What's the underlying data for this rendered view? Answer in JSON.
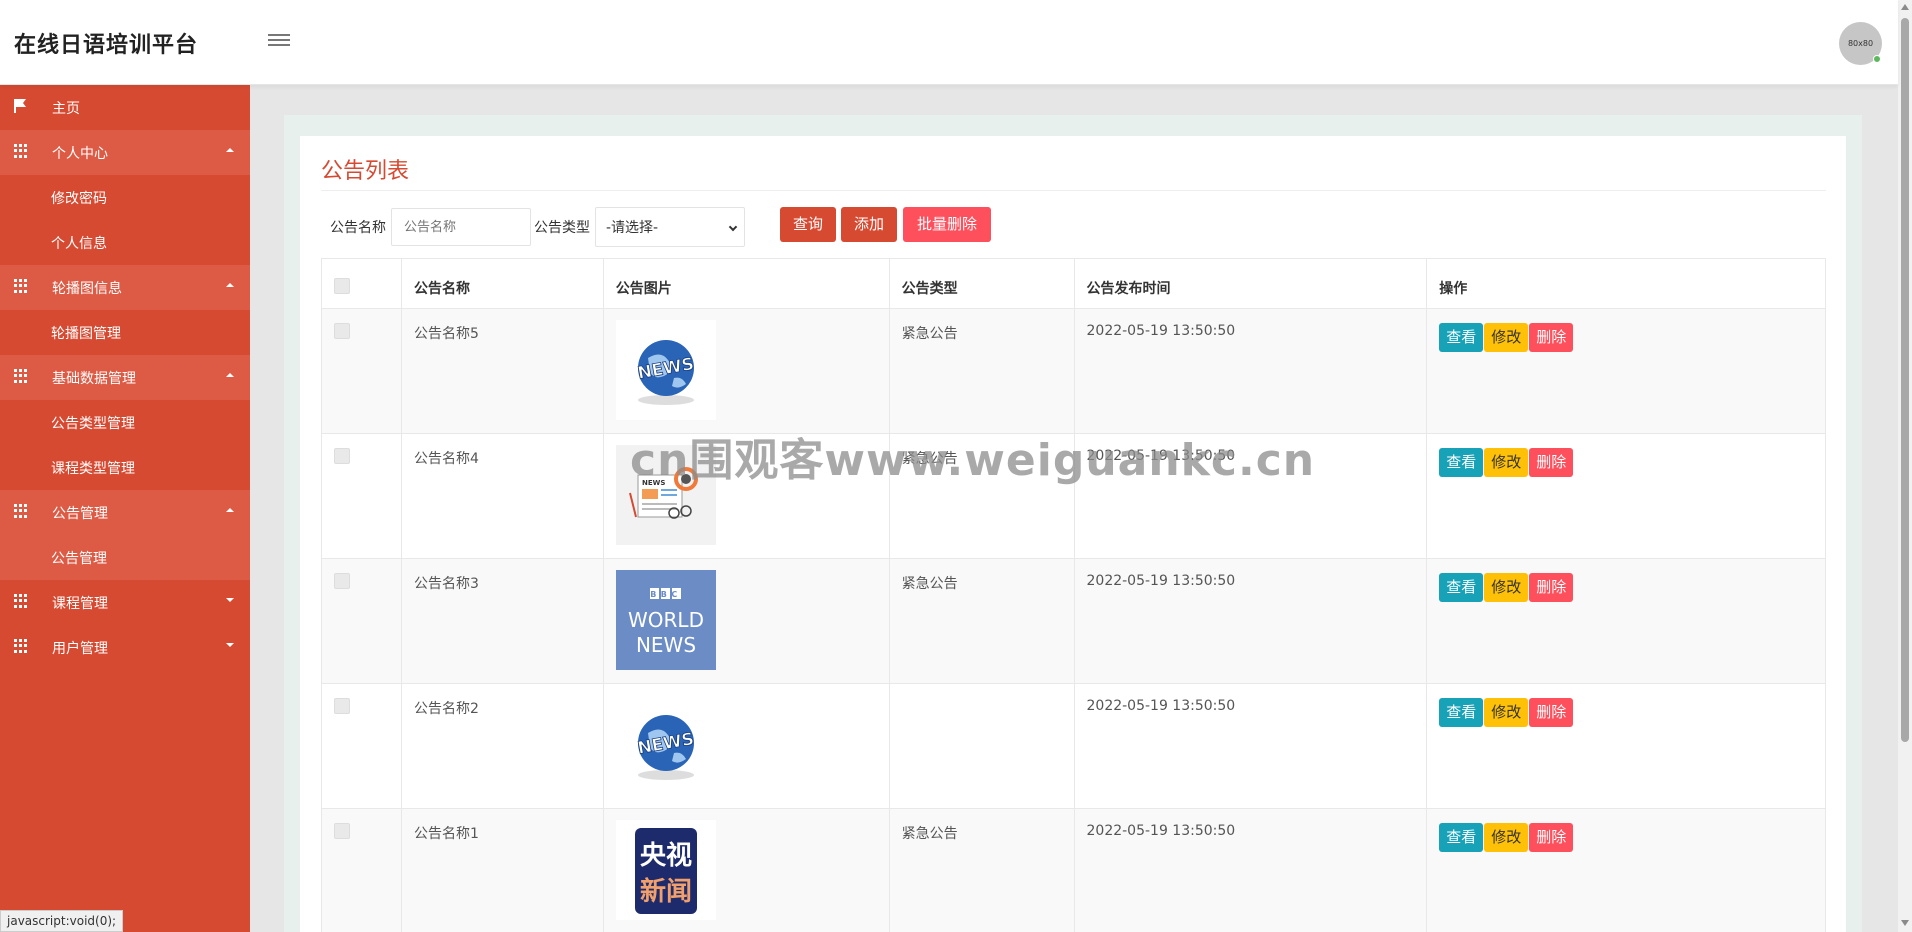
{
  "header": {
    "brand": "在线日语培训平台",
    "avatar_text": "80x80"
  },
  "sidebar": {
    "items": [
      {
        "label": "主页",
        "kind": "top",
        "icon": "flag-icon"
      },
      {
        "label": "个人中心",
        "kind": "parent",
        "icon": "grid-icon",
        "expanded": true
      },
      {
        "label": "修改密码",
        "kind": "sub"
      },
      {
        "label": "个人信息",
        "kind": "sub"
      },
      {
        "label": "轮播图信息",
        "kind": "parent",
        "icon": "grid-icon",
        "expanded": true
      },
      {
        "label": "轮播图管理",
        "kind": "sub"
      },
      {
        "label": "基础数据管理",
        "kind": "parent",
        "icon": "grid-icon",
        "expanded": true
      },
      {
        "label": "公告类型管理",
        "kind": "sub"
      },
      {
        "label": "课程类型管理",
        "kind": "sub"
      },
      {
        "label": "公告管理",
        "kind": "parent",
        "icon": "grid-icon",
        "expanded": true
      },
      {
        "label": "公告管理",
        "kind": "sub"
      },
      {
        "label": "课程管理",
        "kind": "parent",
        "icon": "grid-icon",
        "expanded": false
      },
      {
        "label": "用户管理",
        "kind": "parent",
        "icon": "grid-icon",
        "expanded": false
      }
    ]
  },
  "main": {
    "title": "公告列表",
    "search": {
      "name_label": "公告名称",
      "name_placeholder": "公告名称",
      "type_label": "公告类型",
      "type_selected": "-请选择-"
    },
    "buttons": {
      "query": "查询",
      "add": "添加",
      "bulk_delete": "批量删除"
    },
    "table": {
      "headers": [
        "",
        "公告名称",
        "公告图片",
        "公告类型",
        "公告发布时间",
        "操作"
      ],
      "rows": [
        {
          "name": "公告名称5",
          "image": "news-globe",
          "type": "紧急公告",
          "time": "2022-05-19 13:50:50"
        },
        {
          "name": "公告名称4",
          "image": "news-paper",
          "type": "紧急公告",
          "time": "2022-05-19 13:50:50"
        },
        {
          "name": "公告名称3",
          "image": "bbc-world-news",
          "type": "紧急公告",
          "time": "2022-05-19 13:50:50"
        },
        {
          "name": "公告名称2",
          "image": "news-globe",
          "type": "",
          "time": "2022-05-19 13:50:50"
        },
        {
          "name": "公告名称1",
          "image": "cctv-news",
          "type": "紧急公告",
          "time": "2022-05-19 13:50:50"
        }
      ],
      "actions": {
        "view": "查看",
        "edit": "修改",
        "delete": "删除"
      }
    }
  },
  "images": {
    "bbc_line1": "BBC",
    "bbc_line2": "WORLD",
    "bbc_line3": "NEWS",
    "cctv_line1": "央视",
    "cctv_line2": "新闻",
    "globe_text": "NEWS",
    "paper_text": "NEWS"
  },
  "watermark": "cn围观客www.weiguankc.cn",
  "statusbar": "javascript:void(0);",
  "colors": {
    "primary": "#d64a32",
    "danger": "#fd4f5c",
    "info": "#17a2b8",
    "warning": "#ffc107"
  }
}
